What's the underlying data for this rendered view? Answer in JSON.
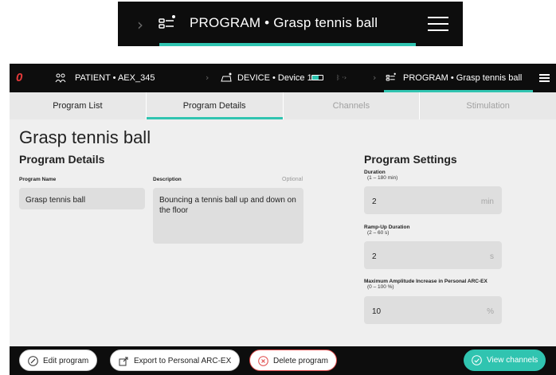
{
  "zoom": {
    "title": "PROGRAM • Grasp tennis ball"
  },
  "topbar": {
    "patient": "PATIENT • AEX_345",
    "device": "DEVICE • Device 1",
    "program": "PROGRAM • Grasp tennis ball"
  },
  "tabs": [
    {
      "label": "Program List"
    },
    {
      "label": "Program Details"
    },
    {
      "label": "Channels"
    },
    {
      "label": "Stimulation"
    }
  ],
  "page": {
    "title": "Grasp tennis ball"
  },
  "details": {
    "heading": "Program Details",
    "name_label": "Program Name",
    "name_value": "Grasp tennis ball",
    "desc_label": "Description",
    "desc_optional": "Optional",
    "desc_value": "Bouncing a tennis ball up and down on the floor"
  },
  "settings": {
    "heading": "Program Settings",
    "duration_label": "Duration",
    "duration_range": "(1 – 180 min)",
    "duration_value": "2",
    "duration_unit": "min",
    "rampup_label": "Ramp-Up Duration",
    "rampup_range": "(2 – 60 s)",
    "rampup_value": "2",
    "rampup_unit": "s",
    "amp_label": "Maximum Amplitude Increase in Personal ARC-EX",
    "amp_range": "(0 – 100 %)",
    "amp_value": "10",
    "amp_unit": "%"
  },
  "actions": {
    "edit": "Edit program",
    "export": "Export to Personal ARC-EX",
    "delete": "Delete program",
    "view": "View channels"
  },
  "colors": {
    "accent": "#30c4b0",
    "danger": "#e04a4a",
    "bar": "#0d0d0d"
  }
}
